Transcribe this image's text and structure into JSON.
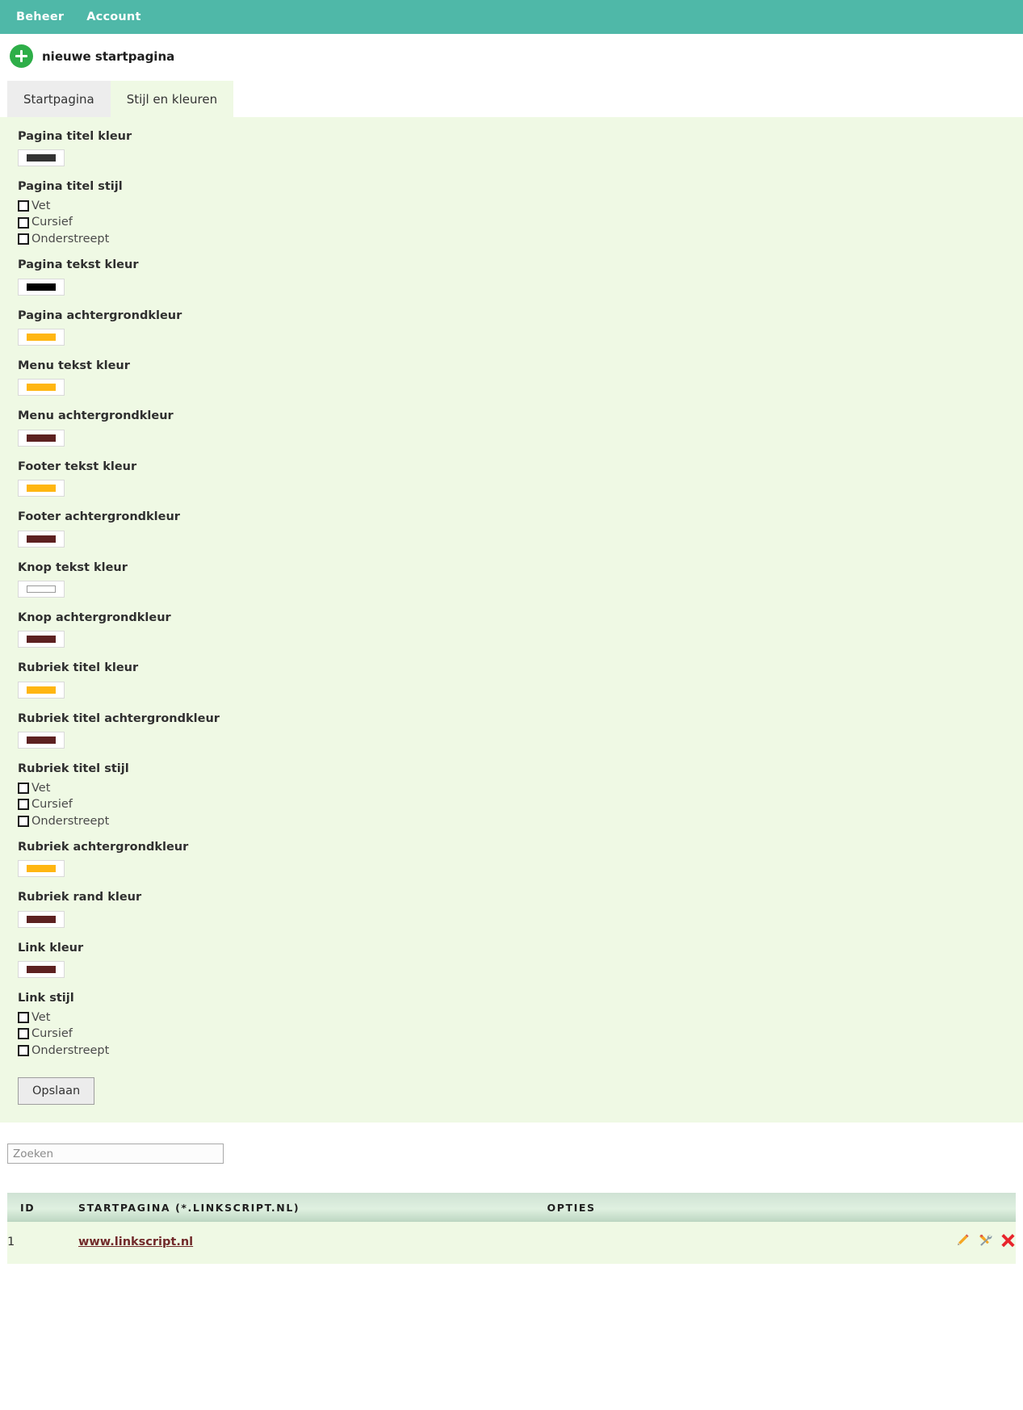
{
  "topbar": {
    "items": [
      {
        "label": "Beheer",
        "name": "nav-beheer"
      },
      {
        "label": "Account",
        "name": "nav-account"
      }
    ]
  },
  "new_page": {
    "icon": "plus-circle-icon",
    "label": "nieuwe startpagina",
    "accent": "#2eae48"
  },
  "tabs": [
    {
      "label": "Startpagina",
      "active": false
    },
    {
      "label": "Stijl en kleuren",
      "active": true
    }
  ],
  "panel": {
    "background": "#eff9e4",
    "fields": [
      {
        "type": "color",
        "label": "Pagina titel kleur",
        "value": "#333333"
      },
      {
        "type": "checkbox",
        "label": "Pagina titel stijl",
        "options": [
          "Vet",
          "Cursief",
          "Onderstreept"
        ],
        "checked": [
          false,
          false,
          false
        ]
      },
      {
        "type": "color",
        "label": "Pagina tekst kleur",
        "value": "#000000"
      },
      {
        "type": "color",
        "label": "Pagina achtergrondkleur",
        "value": "#ffb612"
      },
      {
        "type": "color",
        "label": "Menu tekst kleur",
        "value": "#ffb612"
      },
      {
        "type": "color",
        "label": "Menu achtergrondkleur",
        "value": "#5d2121"
      },
      {
        "type": "color",
        "label": "Footer tekst kleur",
        "value": "#ffb612"
      },
      {
        "type": "color",
        "label": "Footer achtergrondkleur",
        "value": "#5d2121"
      },
      {
        "type": "color",
        "label": "Knop tekst kleur",
        "value": "#ffffff"
      },
      {
        "type": "color",
        "label": "Knop achtergrondkleur",
        "value": "#5d2121"
      },
      {
        "type": "color",
        "label": "Rubriek titel kleur",
        "value": "#ffb612"
      },
      {
        "type": "color",
        "label": "Rubriek titel achtergrondkleur",
        "value": "#5d2121"
      },
      {
        "type": "checkbox",
        "label": "Rubriek titel stijl",
        "options": [
          "Vet",
          "Cursief",
          "Onderstreept"
        ],
        "checked": [
          false,
          false,
          false
        ]
      },
      {
        "type": "color",
        "label": "Rubriek achtergrondkleur",
        "value": "#ffb612"
      },
      {
        "type": "color",
        "label": "Rubriek rand kleur",
        "value": "#5d2121"
      },
      {
        "type": "color",
        "label": "Link kleur",
        "value": "#5d2121"
      },
      {
        "type": "checkbox",
        "label": "Link stijl",
        "options": [
          "Vet",
          "Cursief",
          "Onderstreept"
        ],
        "checked": [
          false,
          false,
          false
        ]
      }
    ],
    "save_label": "Opslaan"
  },
  "search": {
    "placeholder": "Zoeken",
    "value": ""
  },
  "table": {
    "headers": [
      "ID",
      "STARTPAGINA (*.LINKSCRIPT.NL)",
      "OPTIES"
    ],
    "rows": [
      {
        "id": "1",
        "name": "www.linkscript.nl",
        "options": [
          "edit-pencil-icon",
          "tools-icon",
          "delete-cross-icon"
        ]
      }
    ]
  }
}
